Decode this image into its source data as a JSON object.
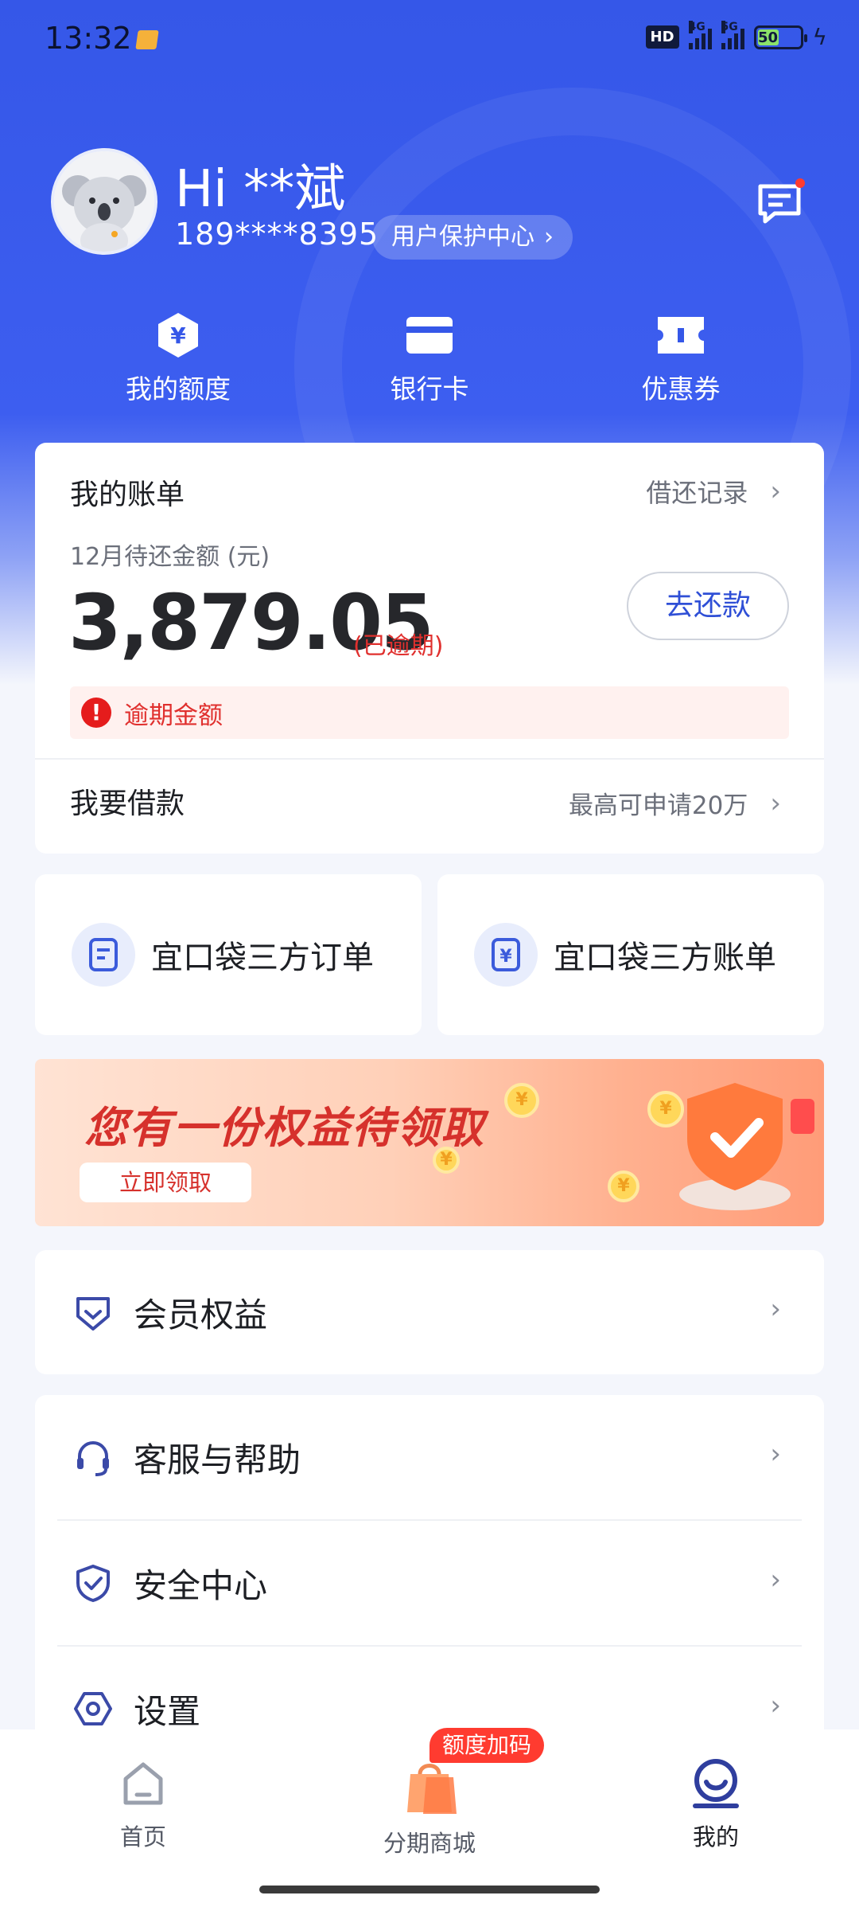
{
  "status_bar": {
    "time": "13:32",
    "hd": "HD",
    "net1": "4G",
    "net2": "5G",
    "battery": "50"
  },
  "profile": {
    "greeting": "Hi **斌",
    "phone": "189****8395",
    "protect_label": "用户保护中心"
  },
  "quick_actions": [
    {
      "label": "我的额度",
      "icon": "yuan-hexagon-icon"
    },
    {
      "label": "银行卡",
      "icon": "bank-card-icon"
    },
    {
      "label": "优惠券",
      "icon": "coupon-icon"
    }
  ],
  "bill": {
    "title": "我的账单",
    "history_link": "借还记录",
    "due_label": "12月待还金额 (元)",
    "amount": "3,879.05",
    "overdue_tag": "(已逾期)",
    "repay_button": "去还款",
    "alert_text": "逾期金额",
    "borrow_title": "我要借款",
    "borrow_hint": "最高可申请20万"
  },
  "third_party": [
    {
      "label": "宜口袋三方订单",
      "icon": "order-doc-icon"
    },
    {
      "label": "宜口袋三方账单",
      "icon": "yuan-bill-icon"
    }
  ],
  "banner": {
    "title": "您有一份权益待领取",
    "button": "立即领取"
  },
  "menu_single": {
    "label": "会员权益",
    "icon": "member-badge-icon"
  },
  "menu_group": [
    {
      "label": "客服与帮助",
      "icon": "headset-icon"
    },
    {
      "label": "安全中心",
      "icon": "shield-check-icon"
    },
    {
      "label": "设置",
      "icon": "settings-hexagon-icon"
    }
  ],
  "tabbar": {
    "tabs": [
      {
        "label": "首页",
        "icon": "home-icon"
      },
      {
        "label": "分期商城",
        "icon": "shopping-bag-icon"
      },
      {
        "label": "我的",
        "icon": "profile-smile-icon"
      }
    ],
    "promo_tag": "额度加码"
  },
  "colors": {
    "brand_blue": "#3557e8",
    "alert_red": "#e0302e",
    "link_blue": "#2f4fd6"
  }
}
